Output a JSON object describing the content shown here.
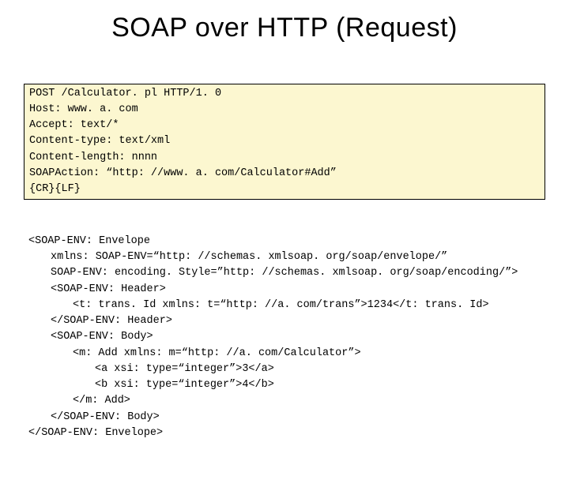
{
  "title": "SOAP over HTTP (Request)",
  "http": {
    "l1": "POST /Calculator. pl HTTP/1. 0",
    "l2": "Host: www. a. com",
    "l3": "Accept: text/*",
    "l4": "Content-type: text/xml",
    "l5": "Content-length: nnnn",
    "l6": "SOAPAction: “http: //www. a. com/Calculator#Add”",
    "l7": "{CR}{LF}"
  },
  "soap": {
    "l1": "<SOAP-ENV: Envelope",
    "l2": "xmlns: SOAP-ENV=“http: //schemas. xmlsoap. org/soap/envelope/”",
    "l3": "SOAP-ENV: encoding. Style=”http: //schemas. xmlsoap. org/soap/encoding/”>",
    "l4": "<SOAP-ENV: Header>",
    "l5": "<t: trans. Id xmlns: t=“http: //a. com/trans”>1234</t: trans. Id>",
    "l6": "</SOAP-ENV: Header>",
    "l7": "<SOAP-ENV: Body>",
    "l8": "<m: Add xmlns: m=“http: //a. com/Calculator”>",
    "l9": "<a xsi: type=“integer”>3</a>",
    "l10": "<b xsi: type=“integer”>4</b>",
    "l11": "</m: Add>",
    "l12": "</SOAP-ENV: Body>",
    "l13": "</SOAP-ENV: Envelope>"
  }
}
